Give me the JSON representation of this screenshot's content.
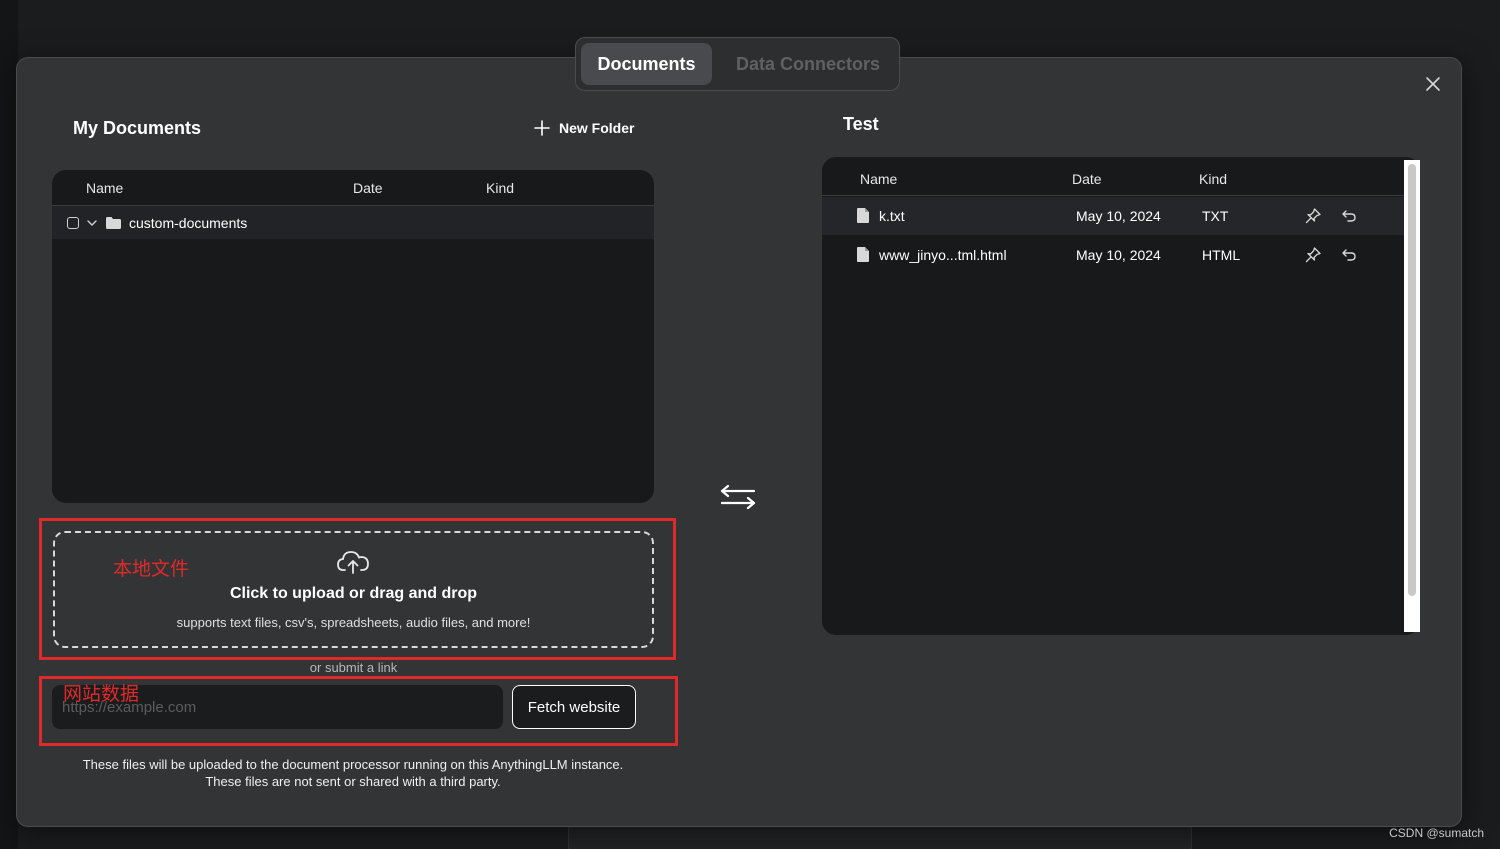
{
  "tabs": [
    {
      "label": "Documents",
      "active": true
    },
    {
      "label": "Data Connectors",
      "active": false
    }
  ],
  "my_documents": {
    "title": "My Documents",
    "new_folder_label": "New Folder",
    "columns": [
      "Name",
      "Date",
      "Kind"
    ],
    "folder": {
      "name": "custom-documents"
    }
  },
  "workspace": {
    "title": "Test",
    "columns": [
      "Name",
      "Date",
      "Kind"
    ],
    "files": [
      {
        "name": "k.txt",
        "date": "May 10, 2024",
        "kind": "TXT"
      },
      {
        "name": "www_jinyo...tml.html",
        "date": "May 10, 2024",
        "kind": "HTML"
      }
    ]
  },
  "upload": {
    "annotation": "本地文件",
    "title": "Click to upload or drag and drop",
    "subtitle": "supports text files, csv's, spreadsheets, audio files, and more!",
    "or_link": "or submit a link"
  },
  "link": {
    "annotation": "网站数据",
    "placeholder": "https://example.com",
    "button_label": "Fetch website"
  },
  "footer": {
    "line1": "These files will be uploaded to the document processor running on this AnythingLLM instance.",
    "line2": "These files are not sent or shared with a third party."
  },
  "watermark": "CSDN @sumatch",
  "colors": {
    "annotation_red": "#e02a2a",
    "modal_bg": "#323436",
    "panel_bg": "#18191b"
  }
}
